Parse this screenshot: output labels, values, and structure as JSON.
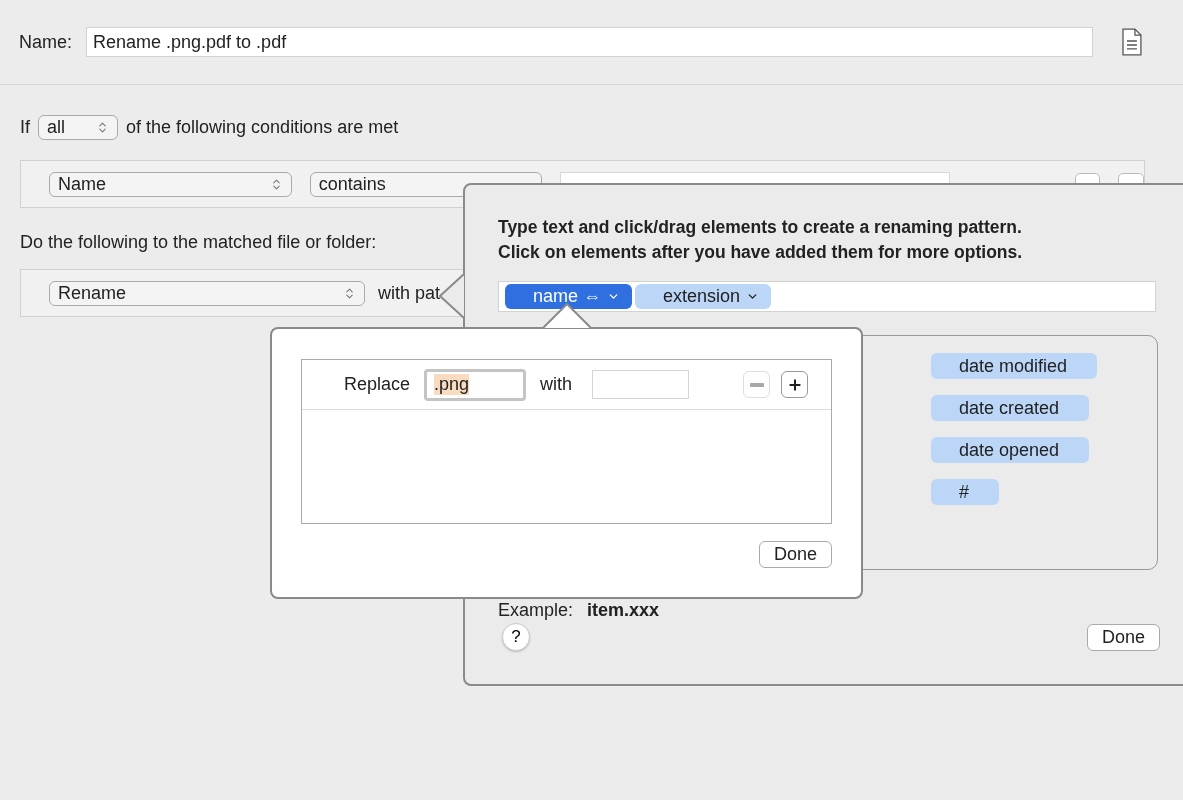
{
  "name_field": {
    "label": "Name:",
    "value": "Rename .png.pdf to .pdf"
  },
  "conditions_header": {
    "prefix": "If",
    "match": "all",
    "suffix": "of the following conditions are met"
  },
  "conditions": [
    {
      "attribute": "Name",
      "operator": "contains"
    }
  ],
  "actions_header": "Do the following to the matched file or folder:",
  "actions": [
    {
      "action": "Rename",
      "suffix": "with pat"
    }
  ],
  "pattern_popover": {
    "instructions": [
      "Type text and click/drag elements to create a renaming pattern.",
      "Click on elements after you have added them for more options."
    ],
    "tokens": [
      {
        "label": "name ⇔",
        "selected": true
      },
      {
        "label": "extension",
        "selected": false
      }
    ],
    "elements": [
      "date modified",
      "date created",
      "date opened",
      "#"
    ],
    "example_label": "Example:",
    "example_value": "item.xxx",
    "help": "?",
    "done": "Done"
  },
  "replace_popover": {
    "rows": [
      {
        "label": "Replace",
        "find": ".png",
        "find_selected": true,
        "with_label": "with",
        "remove_disabled": true
      }
    ],
    "done": "Done"
  }
}
